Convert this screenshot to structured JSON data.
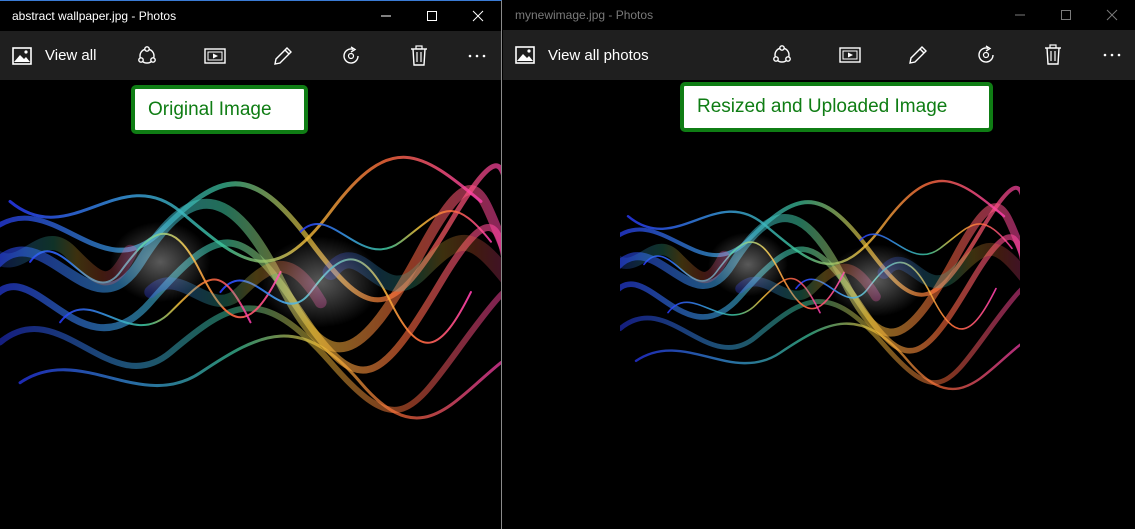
{
  "left_window": {
    "title": "abstract wallpaper.jpg - Photos",
    "view_all_label": "View all",
    "callout_label": "Original Image"
  },
  "right_window": {
    "title": "mynewimage.jpg - Photos",
    "view_all_label": "View all photos",
    "callout_label": "Resized and Uploaded Image"
  },
  "toolbar_icons": [
    "photos-icon",
    "share-icon",
    "slideshow-icon",
    "edit-icon",
    "rotate-icon",
    "delete-icon",
    "more-icon"
  ],
  "window_controls": [
    "minimize-icon",
    "maximize-icon",
    "close-icon"
  ],
  "colors": {
    "callout_border": "#0f7d14",
    "callout_text": "#0f7d14",
    "toolbar_bg": "#1f1f1f",
    "background": "#000000"
  }
}
